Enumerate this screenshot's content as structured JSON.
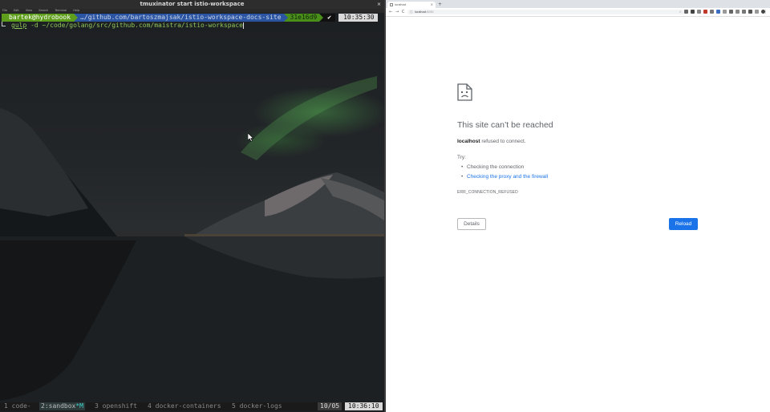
{
  "terminal": {
    "window_title": "tmuxinator start istio-workspace",
    "close_glyph": "×",
    "menu": [
      "File",
      "Edit",
      "View",
      "Search",
      "Terminal",
      "Help"
    ],
    "prompt": {
      "user_host": "bartek@hydrobook",
      "path": "…/github.com/bartoszmajsak/istio-workspace-docs-site",
      "git_hash": "31e16d9",
      "status": "✔",
      "time": "10:35:30"
    },
    "command": {
      "program": "gulp",
      "args": "-d ~/code/golang/src/github.com/maistra/istio-workspace"
    },
    "tmux": {
      "windows": [
        {
          "label": "1 code-",
          "active": false
        },
        {
          "label": "2:sandbox",
          "flag": "*M",
          "active": true
        },
        {
          "label": "3 openshift",
          "active": false
        },
        {
          "label": "4 docker-containers",
          "active": false
        },
        {
          "label": "5 docker-logs",
          "active": false
        }
      ],
      "date": "10/05",
      "time": "10:36:10"
    },
    "colors": {
      "prompt_user_bg": "#5f9e1d",
      "prompt_path_bg": "#2b55a3",
      "command_fg": "#8fc55a",
      "aurora": "#50aa50"
    }
  },
  "browser": {
    "tab": {
      "title": "localhost",
      "close_glyph": "×"
    },
    "new_tab_glyph": "+",
    "nav": {
      "back": "←",
      "forward": "→",
      "reload": "C"
    },
    "omnibox": {
      "info_icon": "ⓘ",
      "host": "localhost",
      "port": ":8080",
      "star": "☆"
    },
    "menu_dots": "⋮",
    "error_page": {
      "title": "This site can’t be reached",
      "host": "localhost",
      "message": "refused to connect.",
      "try_label": "Try:",
      "suggestions": [
        "Checking the connection",
        "Checking the proxy and the firewall"
      ],
      "error_code": "ERR_CONNECTION_REFUSED",
      "details_button": "Details",
      "reload_button": "Reload"
    },
    "colors": {
      "accent": "#1a73e8",
      "text_muted": "#5f6368"
    }
  }
}
